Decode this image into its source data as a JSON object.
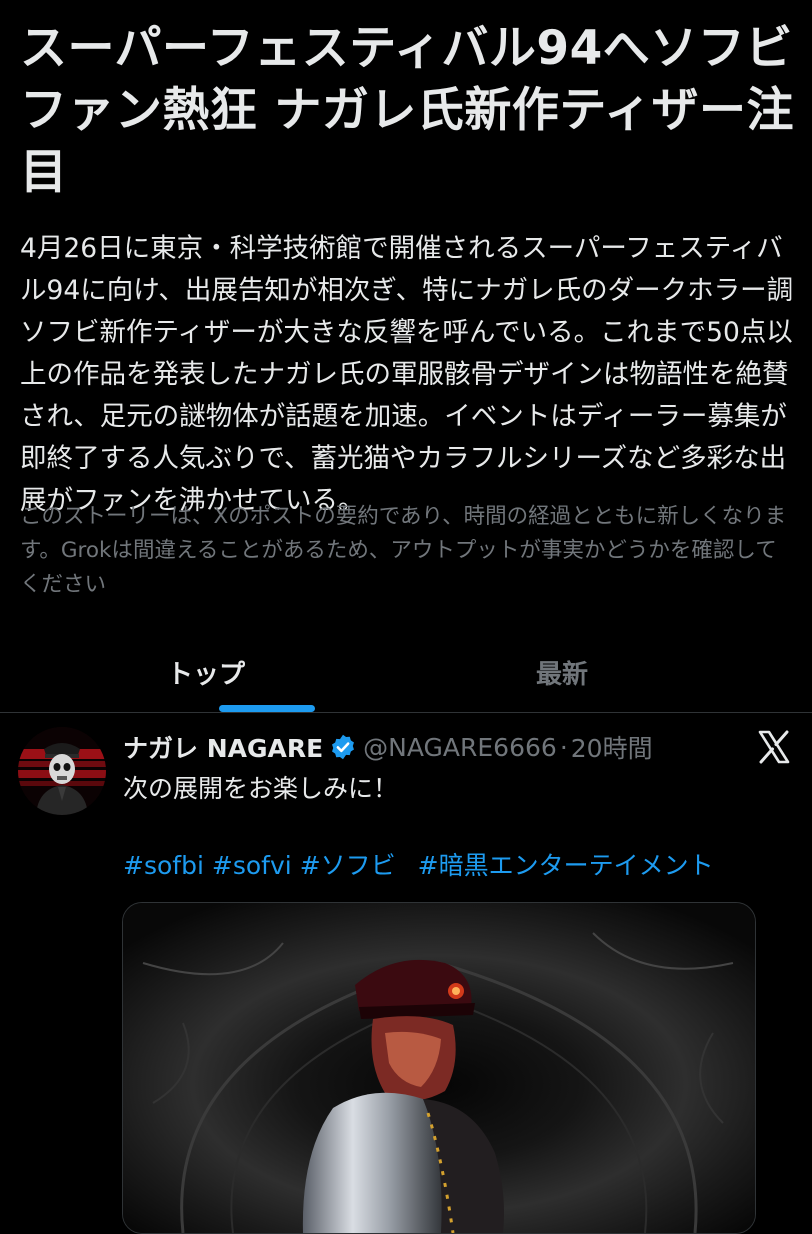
{
  "story": {
    "headline": "スーパーフェスティバル94へソフビファン熱狂 ナガレ氏新作ティザー注目",
    "summary": "4月26日に東京・科学技術館で開催されるスーパーフェスティバル94に向け、出展告知が相次ぎ、特にナガレ氏のダークホラー調ソフビ新作ティザーが大きな反響を呼んでいる。これまで50点以上の作品を発表したナガレ氏の軍服骸骨デザインは物語性を絶賛され、足元の謎物体が話題を加速。イベントはディーラー募集が即終了する人気ぶりで、蓄光猫やカラフルシリーズなど多彩な出展がファンを沸かせている。",
    "disclaimer": "このストーリーは、Xのポストの要約であり、時間の経過とともに新しくなります。Grokは間違えることがあるため、アウトプットが事実かどうかを確認してください"
  },
  "tabs": [
    {
      "label": "トップ",
      "active": true
    },
    {
      "label": "最新",
      "active": false
    }
  ],
  "post": {
    "display_name": "ナガレ NAGARE",
    "verified_icon": "verified-badge-icon",
    "handle": "@NAGARE6666",
    "separator": "·",
    "time": "20時間",
    "text": "次の展開をお楽しみに！",
    "hashtags": [
      "#sofbi",
      "#sofvi",
      "#ソフビ",
      "#暗黒エンターテイメント"
    ],
    "avatar": "avatar-image",
    "media": "post-media-image"
  },
  "colors": {
    "background": "#000000",
    "text_primary": "#e7e9ea",
    "text_secondary": "#71767b",
    "accent": "#1d9bf0",
    "divider": "#2f3336"
  },
  "icons": {
    "brand": "x-logo-icon",
    "verified": "verified-badge-icon"
  }
}
